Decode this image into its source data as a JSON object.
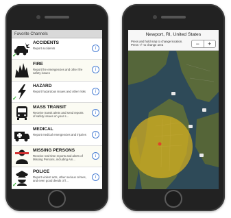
{
  "left_screen": {
    "header": "Favorite Channels",
    "channels": [
      {
        "title": "ACCIDENTS",
        "desc": "Report accidents",
        "icon": "car-crash-icon",
        "checked": true
      },
      {
        "title": "FIRE",
        "desc": "Report fire emergencies and other fire safety issues",
        "icon": "fire-icon",
        "checked": false
      },
      {
        "title": "HAZARD",
        "desc": "Report hazardous issues and other risks",
        "icon": "hazard-lightning-icon",
        "checked": true
      },
      {
        "title": "MASS TRANSIT",
        "desc": "Receive transit alerts and send reports of safety issues on your s...",
        "icon": "bus-icon",
        "checked": false
      },
      {
        "title": "MEDICAL",
        "desc": "Report medical emergencies and injuries",
        "icon": "ambulance-icon",
        "checked": false
      },
      {
        "title": "MISSING PERSONS",
        "desc": "Receive real-time reports and alerts of Missing Persons, including Am...",
        "icon": "missing-person-icon",
        "checked": false
      },
      {
        "title": "POLICE",
        "desc": "Report violent acts, other serious crimes, and even good deeds of l...",
        "icon": "police-icon",
        "checked": true
      }
    ],
    "info_glyph": "i",
    "check_glyph": "✓"
  },
  "right_screen": {
    "title": "Newport, RI, United States",
    "hint": "Press and hold map to change location. Press +/- to change area",
    "zoom_out": "−",
    "zoom_in": "+",
    "colors": {
      "water": "#2e4a58",
      "land": "#5a6a3a",
      "radius": "#d8b21e",
      "pin": "#e0442a"
    }
  }
}
